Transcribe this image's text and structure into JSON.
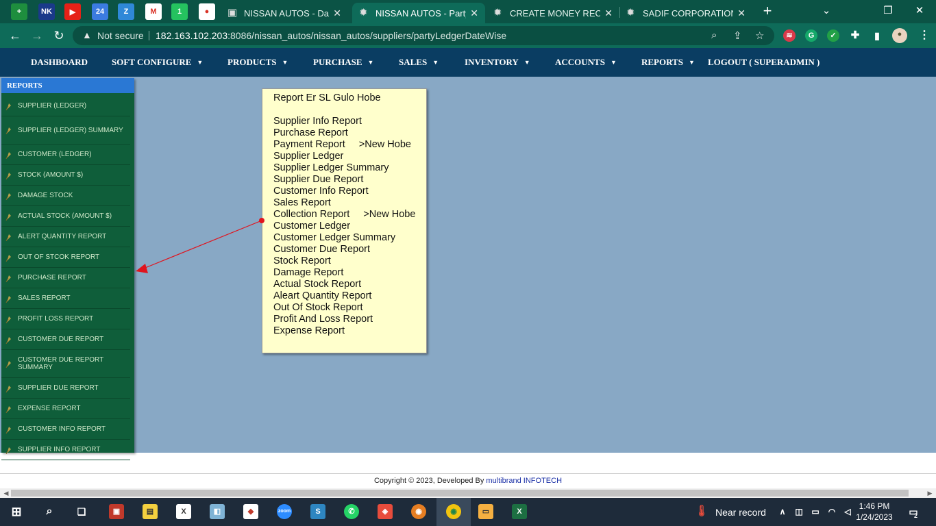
{
  "browser": {
    "pinned_tabs": [
      {
        "name": "sheets",
        "label": "+",
        "color": "#1e8e3e"
      },
      {
        "name": "nk",
        "label": "NK",
        "color": "#1a3a8a"
      },
      {
        "name": "youtube",
        "label": "▶",
        "color": "#e62117"
      },
      {
        "name": "calendar",
        "label": "24",
        "color": "#3b7be0"
      },
      {
        "name": "zoho",
        "label": "Z",
        "color": "#2f88d8"
      },
      {
        "name": "gmail",
        "label": "M",
        "color": "#ffffff"
      },
      {
        "name": "whatsapp",
        "label": "1",
        "color": "#25c25f"
      },
      {
        "name": "photos",
        "label": "●",
        "color": "#ffffff"
      }
    ],
    "tabs": [
      {
        "label": "NISSAN AUTOS - Dashbo",
        "active": false
      },
      {
        "label": "NISSAN AUTOS - PartyLe",
        "active": true
      },
      {
        "label": "CREATE MONEY RECEIPT",
        "active": false
      },
      {
        "label": "SADIF CORPORATION - C",
        "active": false
      }
    ],
    "not_secure": "Not secure",
    "url_host": "182.163.102.203",
    "url_rest": ":8086/nissan_autos/nissan_autos/suppliers/partyLedgerDateWise"
  },
  "nav": {
    "items": [
      {
        "label": "DASHBOARD",
        "caret": false
      },
      {
        "label": "SOFT CONFIGURE",
        "caret": true
      },
      {
        "label": "PRODUCTS",
        "caret": true
      },
      {
        "label": "PURCHASE",
        "caret": true
      },
      {
        "label": "SALES",
        "caret": true
      },
      {
        "label": "INVENTORY",
        "caret": true
      },
      {
        "label": "ACCOUNTS",
        "caret": true
      },
      {
        "label": "REPORTS",
        "caret": true
      },
      {
        "label": "LOGOUT ( SUPERADMIN )",
        "caret": false
      }
    ]
  },
  "sidebar": {
    "title": "REPORTS",
    "items": [
      "SUPPLIER (LEDGER)",
      "SUPPLIER (LEDGER) SUMMARY",
      "CUSTOMER (LEDGER)",
      "STOCK (AMOUNT $)",
      "DAMAGE STOCK",
      "ACTUAL STOCK (AMOUNT $)",
      "ALERT QUANTITY REPORT",
      "OUT OF STCOK REPORT",
      "PURCHASE REPORT",
      "SALES REPORT",
      "PROFIT LOSS REPORT",
      "CUSTOMER DUE REPORT",
      "CUSTOMER DUE REPORT SUMMARY",
      "SUPPLIER DUE REPORT",
      "EXPENSE REPORT",
      "CUSTOMER INFO REPORT",
      "SUPPLIER INFO REPORT"
    ]
  },
  "note": {
    "title": "Report Er SL Gulo Hobe",
    "lines": [
      {
        "text": "Supplier Info Report",
        "extra": ""
      },
      {
        "text": "Purchase Report",
        "extra": ""
      },
      {
        "text": "Payment Report",
        "extra": ">New Hobe"
      },
      {
        "text": "Supplier Ledger",
        "extra": ""
      },
      {
        "text": "Supplier Ledger Summary",
        "extra": ""
      },
      {
        "text": "Supplier Due Report",
        "extra": ""
      },
      {
        "text": "Customer Info Report",
        "extra": ""
      },
      {
        "text": "Sales Report",
        "extra": ""
      },
      {
        "text": "Collection Report",
        "extra": ">New Hobe"
      },
      {
        "text": "Customer Ledger",
        "extra": ""
      },
      {
        "text": "Customer Ledger Summary",
        "extra": ""
      },
      {
        "text": "Customer Due Report",
        "extra": ""
      },
      {
        "text": "Stock Report",
        "extra": ""
      },
      {
        "text": "Damage Report",
        "extra": ""
      },
      {
        "text": "Actual Stock Report",
        "extra": ""
      },
      {
        "text": "Aleart Quantity Report",
        "extra": ""
      },
      {
        "text": "Out Of Stock Report",
        "extra": ""
      },
      {
        "text": "Profit And Loss Report",
        "extra": ""
      },
      {
        "text": "Expense Report",
        "extra": ""
      }
    ]
  },
  "footer": {
    "text": "Copyright © 2023, Developed By ",
    "link": "multibrand INFOTECH"
  },
  "taskbar": {
    "weather": "Near record",
    "time": "1:46 PM",
    "date": "1/24/2023",
    "notifications": "2"
  },
  "colors": {
    "nav_bg": "#0a3d62",
    "sidebar_bg": "#0f5e3a",
    "sidebar_head": "#2a78d4",
    "content_bg": "#88a8c5",
    "note_bg": "#ffffcc",
    "arrow": "#e0141e"
  }
}
